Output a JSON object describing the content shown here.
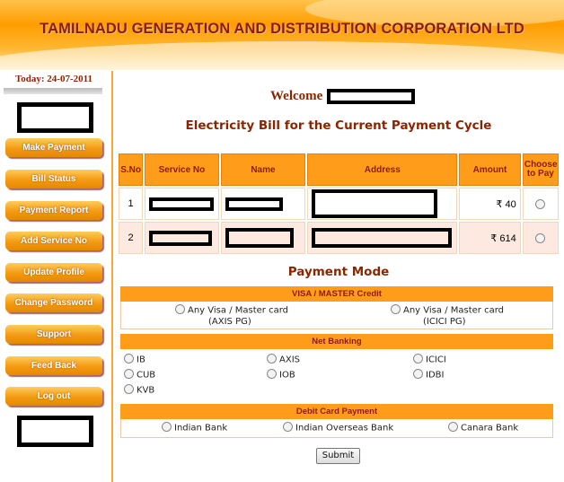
{
  "header": {
    "title": "TAMILNADU GENERATION AND DISTRIBUTION CORPORATION LTD"
  },
  "sidebar": {
    "today": "Today: 24-07-2011",
    "items": [
      {
        "label": "Make Payment"
      },
      {
        "label": "Bill Status"
      },
      {
        "label": "Payment Report"
      },
      {
        "label": "Add Service No"
      },
      {
        "label": "Update Profile"
      },
      {
        "label": "Change Password"
      },
      {
        "label": "Support"
      },
      {
        "label": "Feed Back"
      },
      {
        "label": "Log out"
      }
    ]
  },
  "main": {
    "welcome": "Welcome",
    "subtitle": "Electricity Bill for the Current Payment Cycle",
    "table": {
      "headers": [
        "S.No",
        "Service No",
        "Name",
        "Address",
        "Amount",
        "Choose to Pay"
      ],
      "rows": [
        {
          "sno": "1",
          "amount": "₹ 40"
        },
        {
          "sno": "2",
          "amount": "₹ 614"
        }
      ]
    },
    "payment_mode": {
      "title": "Payment Mode",
      "credit": {
        "heading": "VISA / MASTER Credit",
        "options": [
          {
            "label": "Any Visa / Master card",
            "sub": "(AXIS PG)"
          },
          {
            "label": "Any Visa / Master card",
            "sub": "(ICICI PG)"
          }
        ]
      },
      "net_banking": {
        "heading": "Net Banking",
        "options": [
          "IB",
          "AXIS",
          "ICICI",
          "CUB",
          "IOB",
          "IDBI",
          "KVB"
        ]
      },
      "debit": {
        "heading": "Debit Card Payment",
        "options": [
          "Indian Bank",
          "Indian Overseas Bank",
          "Canara Bank"
        ]
      }
    },
    "submit_label": "Submit"
  }
}
